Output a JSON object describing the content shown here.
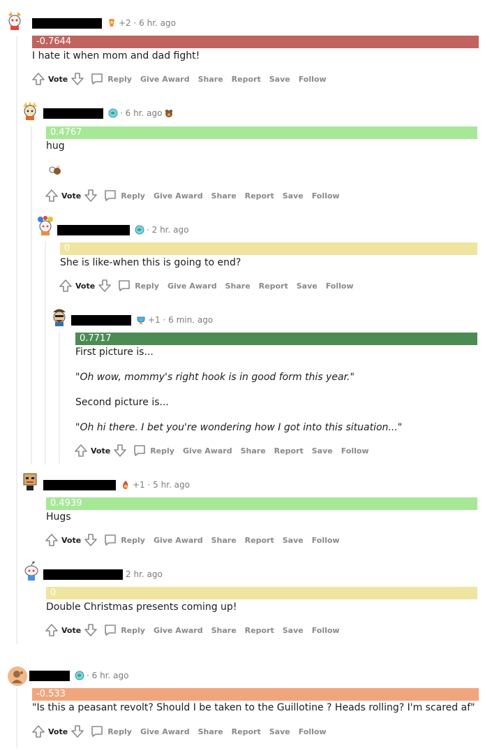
{
  "actions": {
    "vote": "Vote",
    "reply": "Reply",
    "give_award": "Give Award",
    "share": "Share",
    "report": "Report",
    "save": "Save",
    "follow": "Follow"
  },
  "colors": {
    "negative_strong": "#c1635f",
    "negative_mild": "#f1a57d",
    "neutral": "#efe5a0",
    "positive_light": "#a6e896",
    "positive_strong": "#4c8c54"
  },
  "comments": [
    {
      "id": "c1",
      "meta": "+2 · 6 hr. ago",
      "score": "-0.7644",
      "body": [
        "I hate it when mom and dad fight!"
      ]
    },
    {
      "id": "c2",
      "meta": "· 6 hr. ago",
      "score": "0.4767",
      "body": [
        "hug"
      ]
    },
    {
      "id": "c3",
      "meta": "· 2 hr. ago",
      "score": "0",
      "body": [
        "She is like-when this is going to end?"
      ]
    },
    {
      "id": "c4",
      "meta": "+1 · 6 min. ago",
      "score": "0.7717",
      "body": [
        "First picture is...",
        "\"Oh wow, mommy's right hook is in good form this year.\"",
        "Second picture is...",
        "\"Oh hi there. I bet you're wondering how I got into this situation...\""
      ]
    },
    {
      "id": "c5",
      "meta": "+1 · 5 hr. ago",
      "score": "0.4939",
      "body": [
        "Hugs"
      ]
    },
    {
      "id": "c6",
      "meta": "2 hr. ago",
      "score": "0",
      "body": [
        "Double Christmas presents coming up!"
      ]
    },
    {
      "id": "c7",
      "meta": "· 6 hr. ago",
      "score": "-0.533",
      "body": [
        "\"Is this a peasant revolt? Should I be taken to the Guillotine ? Heads rolling? I'm scared af\""
      ]
    }
  ]
}
